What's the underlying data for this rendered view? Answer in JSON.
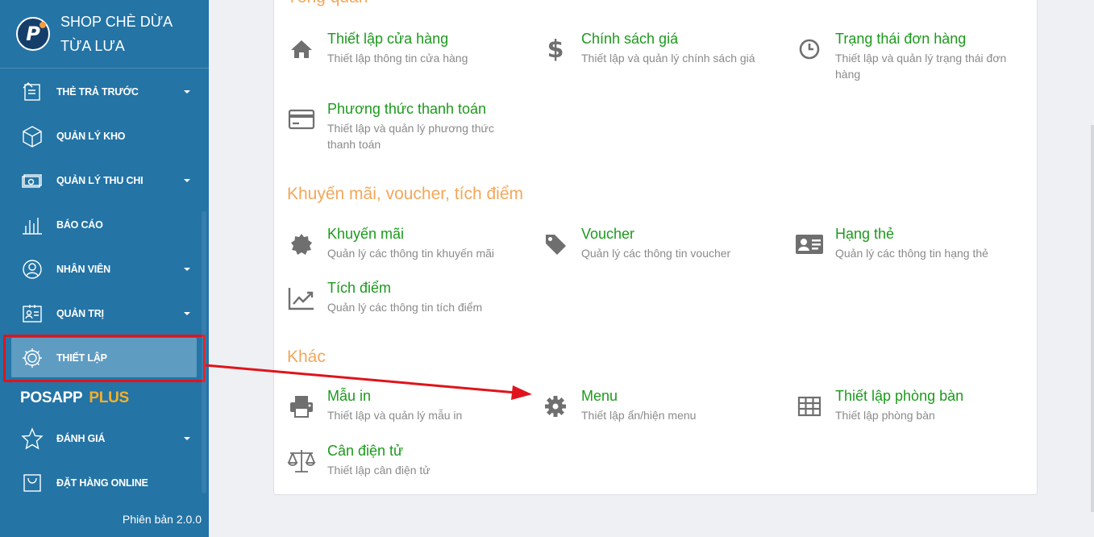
{
  "brand": {
    "name": "SHOP CHÈ DỪA TỪA LƯA"
  },
  "sidebar": {
    "items": [
      {
        "label": "THẺ TRẢ TRƯỚC",
        "icon": "card-icon",
        "caret": true
      },
      {
        "label": "QUẢN LÝ KHO",
        "icon": "box-icon",
        "caret": false
      },
      {
        "label": "QUẢN LÝ THU CHI",
        "icon": "cash-icon",
        "caret": true
      },
      {
        "label": "BÁO CÁO",
        "icon": "bar-chart-icon",
        "caret": false
      },
      {
        "label": "NHÂN VIÊN",
        "icon": "user-icon",
        "caret": true
      },
      {
        "label": "QUẢN TRỊ",
        "icon": "admin-icon",
        "caret": true
      },
      {
        "label": "THIẾT LẬP",
        "icon": "gear-icon",
        "caret": false,
        "active": true
      },
      {
        "label": "ĐÁNH GIÁ",
        "icon": "star-icon",
        "caret": true
      },
      {
        "label": "ĐẶT HÀNG ONLINE",
        "icon": "bag-icon",
        "caret": false
      }
    ],
    "posapp": "POSAPP",
    "plus": "PLUS",
    "version": "Phiên bản 2.0.0"
  },
  "sections": {
    "overview": {
      "title": "Tổng quan"
    },
    "promo": {
      "title": "Khuyến mãi, voucher, tích điểm"
    },
    "other": {
      "title": "Khác"
    }
  },
  "items": {
    "store": {
      "title": "Thiết lập cửa hàng",
      "desc": "Thiết lập thông tin cửa hàng",
      "icon": "home-icon"
    },
    "price": {
      "title": "Chính sách giá",
      "desc": "Thiết lập và quản lý chính sách giá",
      "icon": "dollar-icon"
    },
    "order_status": {
      "title": "Trạng thái đơn hàng",
      "desc": "Thiết lập và quản lý trạng thái đơn hàng",
      "icon": "clock-icon"
    },
    "payment": {
      "title": "Phương thức thanh toán",
      "desc": "Thiết lập và quản lý phương thức thanh toán",
      "icon": "credit-card-icon"
    },
    "promotion": {
      "title": "Khuyến mãi",
      "desc": "Quản lý các thông tin khuyến mãi",
      "icon": "badge-icon"
    },
    "voucher": {
      "title": "Voucher",
      "desc": "Quản lý các thông tin voucher",
      "icon": "tag-icon"
    },
    "card_rank": {
      "title": "Hạng thẻ",
      "desc": "Quản lý các thông tin hạng thẻ",
      "icon": "id-card-icon"
    },
    "points": {
      "title": "Tích điểm",
      "desc": "Quản lý các thông tin tích điểm",
      "icon": "trend-icon"
    },
    "print": {
      "title": "Mẫu in",
      "desc": "Thiết lập và quản lý mẫu in",
      "icon": "printer-icon"
    },
    "menu": {
      "title": "Menu",
      "desc": "Thiết lập ẩn/hiện menu",
      "icon": "cog-icon"
    },
    "rooms": {
      "title": "Thiết lập phòng bàn",
      "desc": "Thiết lập phòng bàn",
      "icon": "table-icon"
    },
    "scale": {
      "title": "Cân điện tử",
      "desc": "Thiết lập cân điện tử",
      "icon": "scale-icon"
    }
  },
  "colors": {
    "sidebar": "#2474a6",
    "title_green": "#1c9a1c",
    "section_orange": "#f3a75a",
    "annotation_red": "#e0141b"
  }
}
